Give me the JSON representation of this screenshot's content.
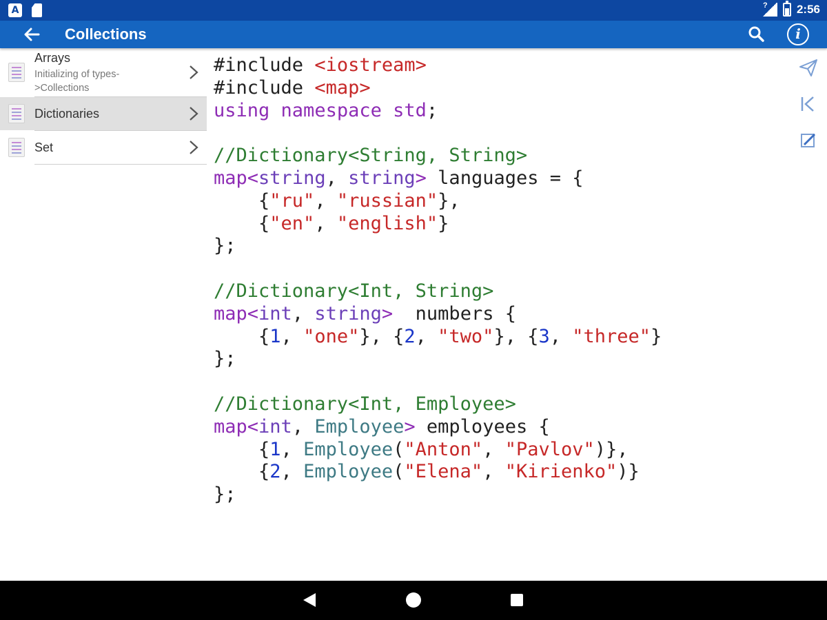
{
  "status_bar": {
    "time": "2:56"
  },
  "app_bar": {
    "title": "Collections"
  },
  "sidebar": {
    "items": [
      {
        "title": "Arrays",
        "subtitle": "Initializing of types->Collections",
        "selected": false
      },
      {
        "title": "Dictionaries",
        "subtitle": "",
        "selected": true
      },
      {
        "title": "Set",
        "subtitle": "",
        "selected": false
      }
    ]
  },
  "code": {
    "lines": [
      "#include <iostream>",
      "#include <map>",
      "using namespace std;",
      "",
      "//Dictionary<String, String>",
      "map<string, string> languages = {",
      "    {\"ru\", \"russian\"},",
      "    {\"en\", \"english\"}",
      "};",
      "",
      "//Dictionary<Int, String>",
      "map<int, string>  numbers {",
      "    {1, \"one\"}, {2, \"two\"}, {3, \"three\"}",
      "};",
      "",
      "//Dictionary<Int, Employee>",
      "map<int, Employee> employees {",
      "    {1, Employee(\"Anton\", \"Pavlov\")},",
      "    {2, Employee(\"Elena\", \"Kirienko\")}",
      "};"
    ]
  },
  "actions": [
    "send-icon",
    "skip-back-icon",
    "edit-icon"
  ],
  "colors": {
    "status_bar": "#0d47a1",
    "app_bar": "#1565c0",
    "keyword": "#8e2db5",
    "type": "#6b3fb8",
    "string": "#c62828",
    "number": "#1a36c8",
    "comment": "#2e7d32",
    "class_name": "#3e7a84"
  }
}
